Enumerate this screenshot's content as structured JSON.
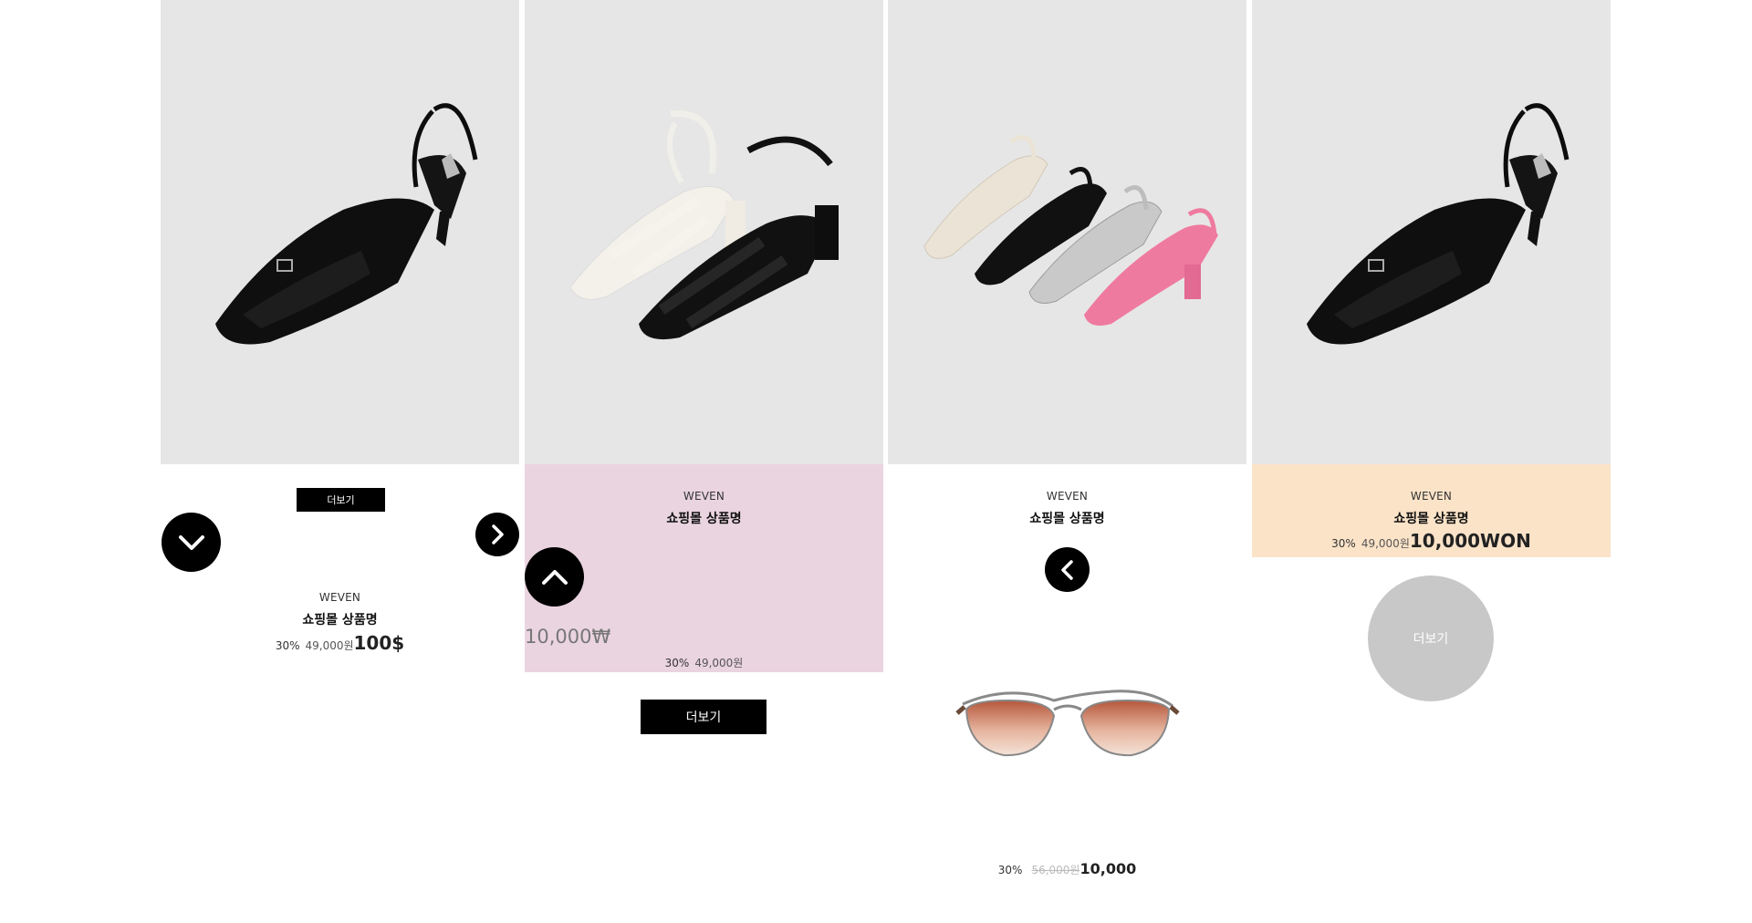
{
  "products": [
    {
      "brand": "WEVEN",
      "name": "쇼핑몰 상품명",
      "discount": "30%",
      "original_price": "49,000원",
      "final_price": "100$",
      "more_label": "더보기",
      "image_icon": "black-slingback-sandal"
    },
    {
      "brand": "WEVEN",
      "name": "쇼핑몰 상품명",
      "discount": "30%",
      "original_price": "49,000원",
      "side_price": "10,000₩",
      "more_label": "더보기",
      "image_icon": "strappy-heel-sandals-white-black",
      "info_bg": "#ead4df"
    },
    {
      "brand": "WEVEN",
      "name": "쇼핑몰 상품명",
      "discount": "30%",
      "original_price": "56,000원",
      "final_price": "10,000",
      "image_icon": "four-color-sandals",
      "extra_image_icon": "aviator-sunglasses"
    },
    {
      "brand": "WEVEN",
      "name": "쇼핑몰 상품명",
      "discount": "30%",
      "original_price": "49,000원",
      "final_price": "10,000WON",
      "more_label": "더보기",
      "image_icon": "black-slingback-sandal",
      "info_bg": "#fbe3c8"
    }
  ],
  "icons": {
    "down": "chevron-down-icon",
    "right": "chevron-right-icon",
    "up": "chevron-up-icon",
    "left": "chevron-left-icon"
  },
  "colors": {
    "image_bg": "#e6e6e6",
    "pink_bg": "#ead4df",
    "peach_bg": "#fbe3c8",
    "button": "#000000",
    "grey_circle": "#c8c8c8"
  }
}
